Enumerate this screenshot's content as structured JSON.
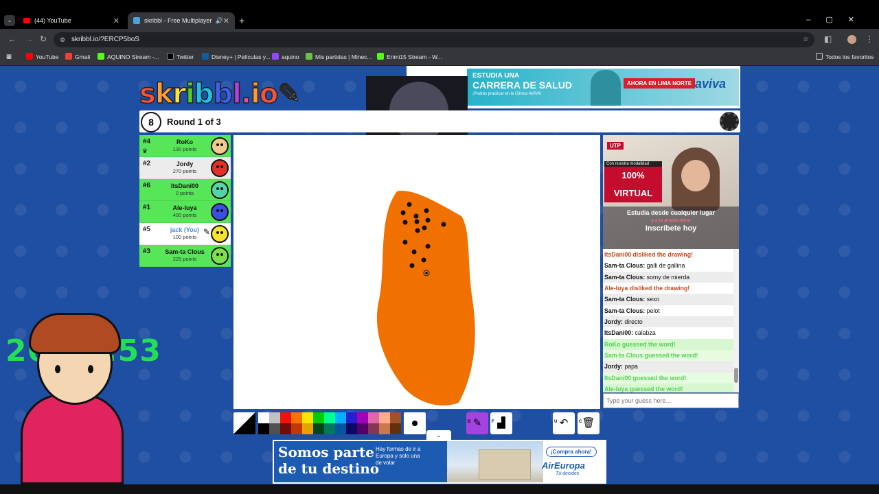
{
  "browser": {
    "tabs": [
      {
        "title": "(44) YouTube",
        "close": "✕"
      },
      {
        "title": "skribbl - Free Multiplayer D",
        "close": "✕"
      }
    ],
    "new_tab": "+",
    "url": "skribbl.io/?ERCP5boS",
    "bookmarks": [
      "YouTube",
      "Gmail",
      "AQUINO Stream -...",
      "Twitter",
      "Disney+ | Películas y...",
      "aquino",
      "Mis partidas | Minec...",
      "Erimi15 Stream - W...",
      "Todos los favoritos"
    ]
  },
  "game": {
    "logo": "skribbl.io",
    "round_number": "8",
    "round_text": "Round 1 of 3",
    "players": [
      {
        "rank": "#4",
        "name": "RoKo",
        "points": "130 points",
        "color": "#57e657",
        "avatar": "#f2c98e"
      },
      {
        "rank": "#2",
        "name": "Jordy",
        "points": "270 points",
        "color": "#ececec",
        "avatar": "#e2302a"
      },
      {
        "rank": "#6",
        "name": "ItsDani00",
        "points": "0 points",
        "color": "#57e657",
        "avatar": "#52d6a8"
      },
      {
        "rank": "#1",
        "name": "Ale-luya",
        "points": "400 points",
        "color": "#57e657",
        "avatar": "#3d4ee3"
      },
      {
        "rank": "#5",
        "name": "jack (You)",
        "points": "100 points",
        "color": "#ffffff",
        "avatar": "#f6e32c"
      },
      {
        "rank": "#3",
        "name": "Sam-ta Clous",
        "points": "225 points",
        "color": "#57e657",
        "avatar": "#7fe04f"
      }
    ],
    "chat": [
      {
        "who": "",
        "text": "ItsDani00 disliked the drawing!",
        "kind": "red"
      },
      {
        "who": "Sam-ta Clous:",
        "text": "galli de gallina",
        "kind": "normal"
      },
      {
        "who": "Sam-ta Clous:",
        "text": "somy de mierda",
        "kind": "normal"
      },
      {
        "who": "",
        "text": "Ale-luya disliked the drawing!",
        "kind": "red"
      },
      {
        "who": "Sam-ta Clous:",
        "text": "sexo",
        "kind": "normal"
      },
      {
        "who": "Sam-ta Clous:",
        "text": "pelot",
        "kind": "normal"
      },
      {
        "who": "Jordy:",
        "text": "directo",
        "kind": "normal"
      },
      {
        "who": "ItsDani00:",
        "text": "calabza",
        "kind": "normal"
      },
      {
        "who": "",
        "text": "RoKo guessed the word!",
        "kind": "green"
      },
      {
        "who": "",
        "text": "Sam-ta Clous guessed the word!",
        "kind": "green"
      },
      {
        "who": "Jordy:",
        "text": "papa",
        "kind": "normal"
      },
      {
        "who": "",
        "text": "ItsDani00 guessed the word!",
        "kind": "green"
      },
      {
        "who": "",
        "text": "Ale-luya guessed the word!",
        "kind": "green"
      }
    ],
    "guess_placeholder": "Type your guess here...",
    "palette_top": [
      "#ffffff",
      "#c1c1c1",
      "#ef130b",
      "#ff7100",
      "#ffe400",
      "#00cc00",
      "#00ff91",
      "#00b2ff",
      "#231fd3",
      "#a300ba",
      "#df69a7",
      "#ffac8e",
      "#a0522d"
    ],
    "palette_bottom": [
      "#000000",
      "#505050",
      "#740b07",
      "#c23800",
      "#e8a200",
      "#004619",
      "#00785d",
      "#00569e",
      "#0e0865",
      "#550069",
      "#873554",
      "#cc774d",
      "#63300d"
    ],
    "tool_keys": {
      "brush": "B",
      "fill": "F",
      "undo": "U",
      "clear": "C"
    }
  },
  "overlay": {
    "timer": "26:38:53"
  },
  "ads": {
    "top": {
      "line1": "ESTUDIA UNA",
      "line2": "CARRERA DE SALUD",
      "line3": "¡Podrás practicar en la Clínica AVIVA!",
      "cta": "AHORA EN LIMA NORTE",
      "brand": "aviva"
    },
    "side": {
      "brand": "UTP",
      "mod": "Con nuestra modalidad",
      "big": "100% VIRTUAL",
      "s1": "Estudia desde cualquier lugar",
      "s2": "y a tu propio ritmo",
      "s3": "Inscríbete hoy"
    },
    "bottom": {
      "h1": "Somos parte",
      "h2": "de tu destino",
      "small": "Hay formas de ir a Europa y solo una de volar",
      "cta": "¡Compra ahora!",
      "brand": "AirEuropa",
      "tag": "Tú decides"
    }
  }
}
